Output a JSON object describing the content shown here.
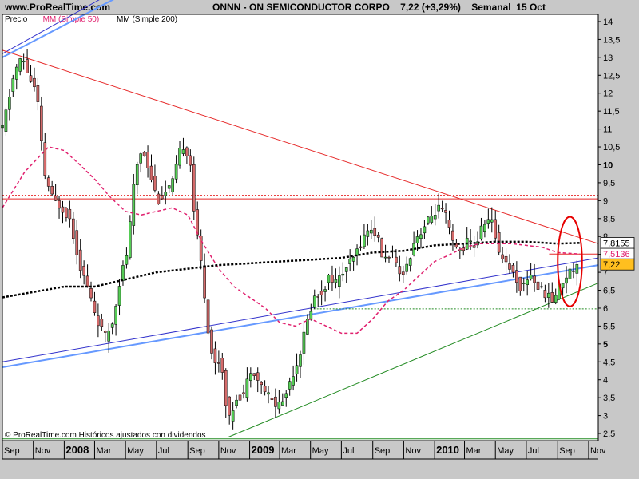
{
  "header": {
    "site": "www.ProRealTime.com",
    "ticker": "ONNN",
    "company": "ON SEMICONDUCTOR CORPO",
    "last": "7,22",
    "change": "(+3,29%)",
    "period": "Semanal",
    "date": "15 Oct"
  },
  "chart_data": {
    "type": "candlestick",
    "title": "ONNN - ON SEMICONDUCTOR CORPO 7,22 (+3,29%) Semanal 15 Oct",
    "legend": [
      {
        "name": "Precio",
        "color": "#000000"
      },
      {
        "name": "MM (Simple 50)",
        "color": "#e0206e"
      },
      {
        "name": "MM (Simple 200)",
        "color": "#000000"
      }
    ],
    "x_tick_labels": [
      "Sep",
      "Nov",
      "2008",
      "Mar",
      "May",
      "Jul",
      "Sep",
      "Nov",
      "2009",
      "Mar",
      "May",
      "Jul",
      "Sep",
      "Nov",
      "2010",
      "Mar",
      "May",
      "Jul",
      "Sep",
      "Nov"
    ],
    "y_ticks": [
      2.5,
      3,
      3.5,
      4,
      4.5,
      5,
      5.5,
      6,
      6.5,
      7,
      7.5,
      8,
      8.5,
      9,
      9.5,
      10,
      10.5,
      11,
      11.5,
      12,
      12.5,
      13,
      13.5,
      14
    ],
    "y_tick_labels": [
      "2,5",
      "3",
      "3,5",
      "4",
      "4,5",
      "5",
      "5,5",
      "6",
      "6,5",
      "7",
      "7,5",
      "8",
      "8,5",
      "9",
      "9,5",
      "10",
      "10,5",
      "11",
      "11,5",
      "12",
      "12,5",
      "13",
      "13,5",
      "14"
    ],
    "y_bold_labels": [
      "5",
      "10"
    ],
    "ylim": [
      2.3,
      14.2
    ],
    "x_range": [
      "2007-09-01",
      "2010-11-20"
    ],
    "price_key": [
      [
        "2007-09-01",
        11.0
      ],
      [
        "2007-09-25",
        12.6
      ],
      [
        "2007-10-10",
        13.0
      ],
      [
        "2007-10-25",
        12.4
      ],
      [
        "2007-11-08",
        12.0
      ],
      [
        "2007-11-22",
        9.8
      ],
      [
        "2007-12-10",
        9.0
      ],
      [
        "2007-12-28",
        8.8
      ],
      [
        "2008-01-12",
        8.5
      ],
      [
        "2008-02-01",
        7.2
      ],
      [
        "2008-02-18",
        6.5
      ],
      [
        "2008-03-05",
        5.7
      ],
      [
        "2008-03-22",
        5.2
      ],
      [
        "2008-04-05",
        5.6
      ],
      [
        "2008-04-20",
        6.8
      ],
      [
        "2008-05-05",
        7.6
      ],
      [
        "2008-05-20",
        9.8
      ],
      [
        "2008-06-03",
        10.5
      ],
      [
        "2008-06-18",
        9.8
      ],
      [
        "2008-07-03",
        9.0
      ],
      [
        "2008-07-18",
        9.2
      ],
      [
        "2008-08-02",
        9.5
      ],
      [
        "2008-08-20",
        10.6
      ],
      [
        "2008-09-05",
        10.2
      ],
      [
        "2008-09-15",
        8.4
      ],
      [
        "2008-09-28",
        7.2
      ],
      [
        "2008-10-10",
        5.5
      ],
      [
        "2008-10-22",
        4.4
      ],
      [
        "2008-11-05",
        4.6
      ],
      [
        "2008-11-20",
        2.8
      ],
      [
        "2008-12-05",
        3.5
      ],
      [
        "2008-12-20",
        3.6
      ],
      [
        "2009-01-05",
        4.4
      ],
      [
        "2009-01-20",
        3.9
      ],
      [
        "2009-02-05",
        3.6
      ],
      [
        "2009-02-20",
        3.3
      ],
      [
        "2009-03-08",
        3.4
      ],
      [
        "2009-03-22",
        4.0
      ],
      [
        "2009-04-08",
        4.6
      ],
      [
        "2009-04-22",
        5.5
      ],
      [
        "2009-05-08",
        6.3
      ],
      [
        "2009-05-22",
        6.4
      ],
      [
        "2009-06-08",
        6.9
      ],
      [
        "2009-06-22",
        6.7
      ],
      [
        "2009-07-08",
        7.1
      ],
      [
        "2009-07-22",
        7.3
      ],
      [
        "2009-08-08",
        7.8
      ],
      [
        "2009-08-22",
        8.2
      ],
      [
        "2009-09-08",
        8.1
      ],
      [
        "2009-09-22",
        7.3
      ],
      [
        "2009-10-08",
        7.6
      ],
      [
        "2009-10-22",
        6.9
      ],
      [
        "2009-11-08",
        7.2
      ],
      [
        "2009-11-22",
        7.9
      ],
      [
        "2009-12-08",
        8.2
      ],
      [
        "2009-12-22",
        8.5
      ],
      [
        "2010-01-08",
        8.8
      ],
      [
        "2010-01-22",
        8.6
      ],
      [
        "2010-02-08",
        7.7
      ],
      [
        "2010-02-22",
        7.6
      ],
      [
        "2010-03-08",
        7.9
      ],
      [
        "2010-03-22",
        7.7
      ],
      [
        "2010-04-08",
        8.4
      ],
      [
        "2010-04-22",
        8.5
      ],
      [
        "2010-05-08",
        7.6
      ],
      [
        "2010-05-22",
        7.3
      ],
      [
        "2010-06-08",
        6.9
      ],
      [
        "2010-06-22",
        6.5
      ],
      [
        "2010-07-08",
        7.0
      ],
      [
        "2010-07-22",
        6.6
      ],
      [
        "2010-08-08",
        6.4
      ],
      [
        "2010-08-22",
        6.2
      ],
      [
        "2010-09-08",
        6.7
      ],
      [
        "2010-09-22",
        7.0
      ],
      [
        "2010-10-15",
        7.22
      ]
    ],
    "sma50": [
      [
        "2007-09-01",
        8.8
      ],
      [
        "2007-10-15",
        9.8
      ],
      [
        "2007-12-01",
        10.5
      ],
      [
        "2008-01-01",
        10.4
      ],
      [
        "2008-02-01",
        10.0
      ],
      [
        "2008-03-01",
        9.6
      ],
      [
        "2008-04-01",
        9.1
      ],
      [
        "2008-05-01",
        8.7
      ],
      [
        "2008-06-01",
        8.6
      ],
      [
        "2008-07-01",
        8.7
      ],
      [
        "2008-08-01",
        8.8
      ],
      [
        "2008-09-01",
        8.6
      ],
      [
        "2008-10-01",
        7.8
      ],
      [
        "2008-11-01",
        7.1
      ],
      [
        "2008-12-01",
        6.6
      ],
      [
        "2009-01-01",
        6.3
      ],
      [
        "2009-02-01",
        6.0
      ],
      [
        "2009-03-01",
        5.6
      ],
      [
        "2009-04-01",
        5.5
      ],
      [
        "2009-05-01",
        5.7
      ],
      [
        "2009-06-01",
        5.5
      ],
      [
        "2009-07-01",
        5.3
      ],
      [
        "2009-08-01",
        5.3
      ],
      [
        "2009-09-01",
        5.7
      ],
      [
        "2009-10-01",
        6.2
      ],
      [
        "2009-11-01",
        6.5
      ],
      [
        "2009-12-01",
        6.9
      ],
      [
        "2010-01-01",
        7.3
      ],
      [
        "2010-02-01",
        7.5
      ],
      [
        "2010-03-01",
        7.7
      ],
      [
        "2010-04-01",
        7.8
      ],
      [
        "2010-05-01",
        7.8
      ],
      [
        "2010-06-01",
        7.8
      ],
      [
        "2010-07-01",
        7.75
      ],
      [
        "2010-08-01",
        7.7
      ],
      [
        "2010-09-01",
        7.55
      ],
      [
        "2010-10-15",
        7.51
      ]
    ],
    "sma200": [
      [
        "2007-09-01",
        6.3
      ],
      [
        "2007-11-01",
        6.45
      ],
      [
        "2008-01-01",
        6.6
      ],
      [
        "2008-03-01",
        6.6
      ],
      [
        "2008-05-01",
        6.8
      ],
      [
        "2008-07-01",
        7.0
      ],
      [
        "2008-09-01",
        7.1
      ],
      [
        "2008-11-01",
        7.2
      ],
      [
        "2009-01-01",
        7.25
      ],
      [
        "2009-03-01",
        7.3
      ],
      [
        "2009-05-01",
        7.35
      ],
      [
        "2009-07-01",
        7.4
      ],
      [
        "2009-09-01",
        7.55
      ],
      [
        "2009-11-01",
        7.6
      ],
      [
        "2010-01-01",
        7.75
      ],
      [
        "2010-03-01",
        7.8
      ],
      [
        "2010-05-01",
        7.85
      ],
      [
        "2010-07-01",
        7.85
      ],
      [
        "2010-09-01",
        7.8
      ],
      [
        "2010-10-15",
        7.82
      ]
    ],
    "lines": [
      {
        "color": "#3333cc",
        "width": 1,
        "from": [
          "2007-09-01",
          13.1
        ],
        "to": [
          "2008-09-28",
          16.2
        ]
      },
      {
        "color": "#6699ff",
        "width": 2,
        "from": [
          "2007-09-01",
          13.0
        ],
        "to": [
          "2008-09-28",
          15.9
        ]
      },
      {
        "color": "#e62828",
        "width": 1,
        "from": [
          "2007-09-01",
          13.2
        ],
        "to": [
          "2010-11-20",
          7.8
        ]
      },
      {
        "color": "#3333cc",
        "width": 1,
        "from": [
          "2007-09-01",
          4.5
        ],
        "to": [
          "2010-11-20",
          7.4
        ]
      },
      {
        "color": "#6699ff",
        "width": 2,
        "from": [
          "2007-09-01",
          4.35
        ],
        "to": [
          "2010-11-20",
          7.2
        ]
      },
      {
        "color": "#228b22",
        "width": 1,
        "from": [
          "2008-11-20",
          2.4
        ],
        "to": [
          "2010-11-20",
          6.7
        ]
      }
    ],
    "hlines": [
      {
        "value": 9.15,
        "color": "#e62828",
        "style": "dotted",
        "from": "2007-09-01"
      },
      {
        "value": 9.05,
        "color": "#e62828",
        "style": "solid",
        "from": "2007-09-01"
      },
      {
        "value": 7.51,
        "color": "#e62828",
        "style": "solid",
        "from": "2010-08-15"
      },
      {
        "value": 5.98,
        "color": "#228b22",
        "style": "dotted",
        "from": "2009-05-01"
      },
      {
        "value": 2.35,
        "color": "#228b22",
        "style": "solid",
        "from": "2007-09-01"
      }
    ],
    "price_tags": [
      {
        "label": "7,8155",
        "value": 7.8155,
        "bg": "#ffffff",
        "fg": "#000000"
      },
      {
        "label": "7,5136",
        "value": 7.5136,
        "bg": "#ffffff",
        "fg": "#e0206e"
      },
      {
        "label": "7,22",
        "value": 7.22,
        "bg": "#ffbf1f",
        "fg": "#000000"
      }
    ],
    "annotation": {
      "shape": "ellipse",
      "color": "#e60000",
      "center": [
        "2010-09-25",
        7.3
      ],
      "radius_days": 24,
      "radius_value": 1.25
    },
    "footer": "© ProRealTime.com  Históricos ajustados con dividendos",
    "colors": {
      "up": "#55cc55",
      "down": "#d46a6a",
      "background": "#ffffff",
      "grid": "#c8c8c8",
      "sma50": "#e0206e",
      "sma200": "#000000"
    }
  }
}
